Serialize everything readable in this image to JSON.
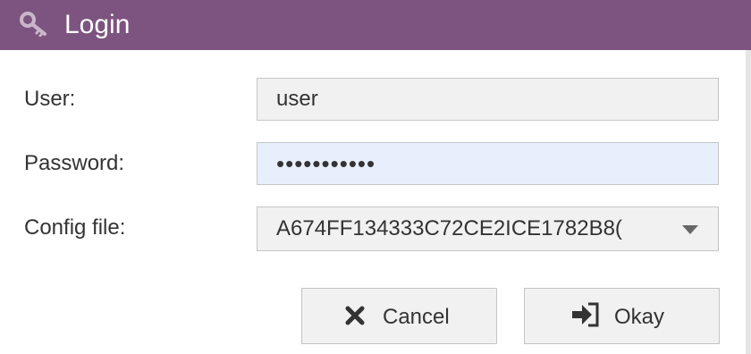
{
  "window": {
    "title": "Login",
    "title_icon": "key-icon",
    "title_bar_color": "#7d5480"
  },
  "form": {
    "user": {
      "label": "User:",
      "value": "user"
    },
    "password": {
      "label": "Password:",
      "value": "•••••••••••"
    },
    "config": {
      "label": "Config file:",
      "value": "A674FF134333C72CE2ICE1782B8(",
      "icon": "chevron-down-icon"
    }
  },
  "buttons": {
    "cancel": {
      "label": "Cancel",
      "icon": "close-icon"
    },
    "okay": {
      "label": "Okay",
      "icon": "sign-in-icon"
    }
  }
}
